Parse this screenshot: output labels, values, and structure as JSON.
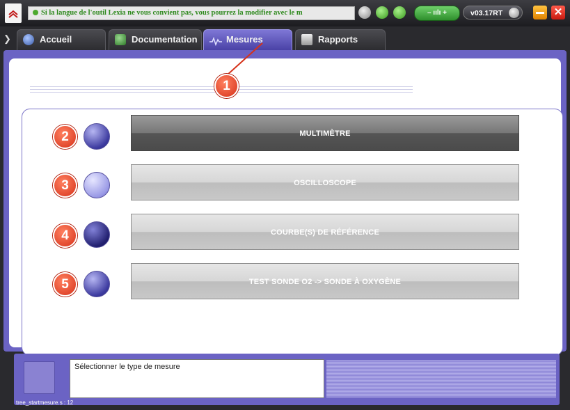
{
  "topbar": {
    "marquee_text": "Si la langue de l'outil Lexia ne vous convient pas, vous pourrez la modifier avec le m",
    "version": "v03.17RT",
    "close_label": "✕"
  },
  "tabs": [
    {
      "label": "Accueil"
    },
    {
      "label": "Documentation"
    },
    {
      "label": "Mesures"
    },
    {
      "label": "Rapports"
    }
  ],
  "menu": [
    {
      "number": "2",
      "label": "MULTIMÈTRE"
    },
    {
      "number": "3",
      "label": "OSCILLOSCOPE"
    },
    {
      "number": "4",
      "label": "COURBE(S) DE RÉFÉRENCE"
    },
    {
      "number": "5",
      "label": "TEST SONDE O2 -> SONDE À OXYGÈNE"
    }
  ],
  "callout": {
    "number": "1"
  },
  "status": {
    "message": "Sélectionner le type de mesure",
    "code": "tree_startmesure.s : 12"
  },
  "colors": {
    "accent": "#6b63c4",
    "callout": "#d6321a",
    "marquee_text": "#2f8a1e"
  }
}
